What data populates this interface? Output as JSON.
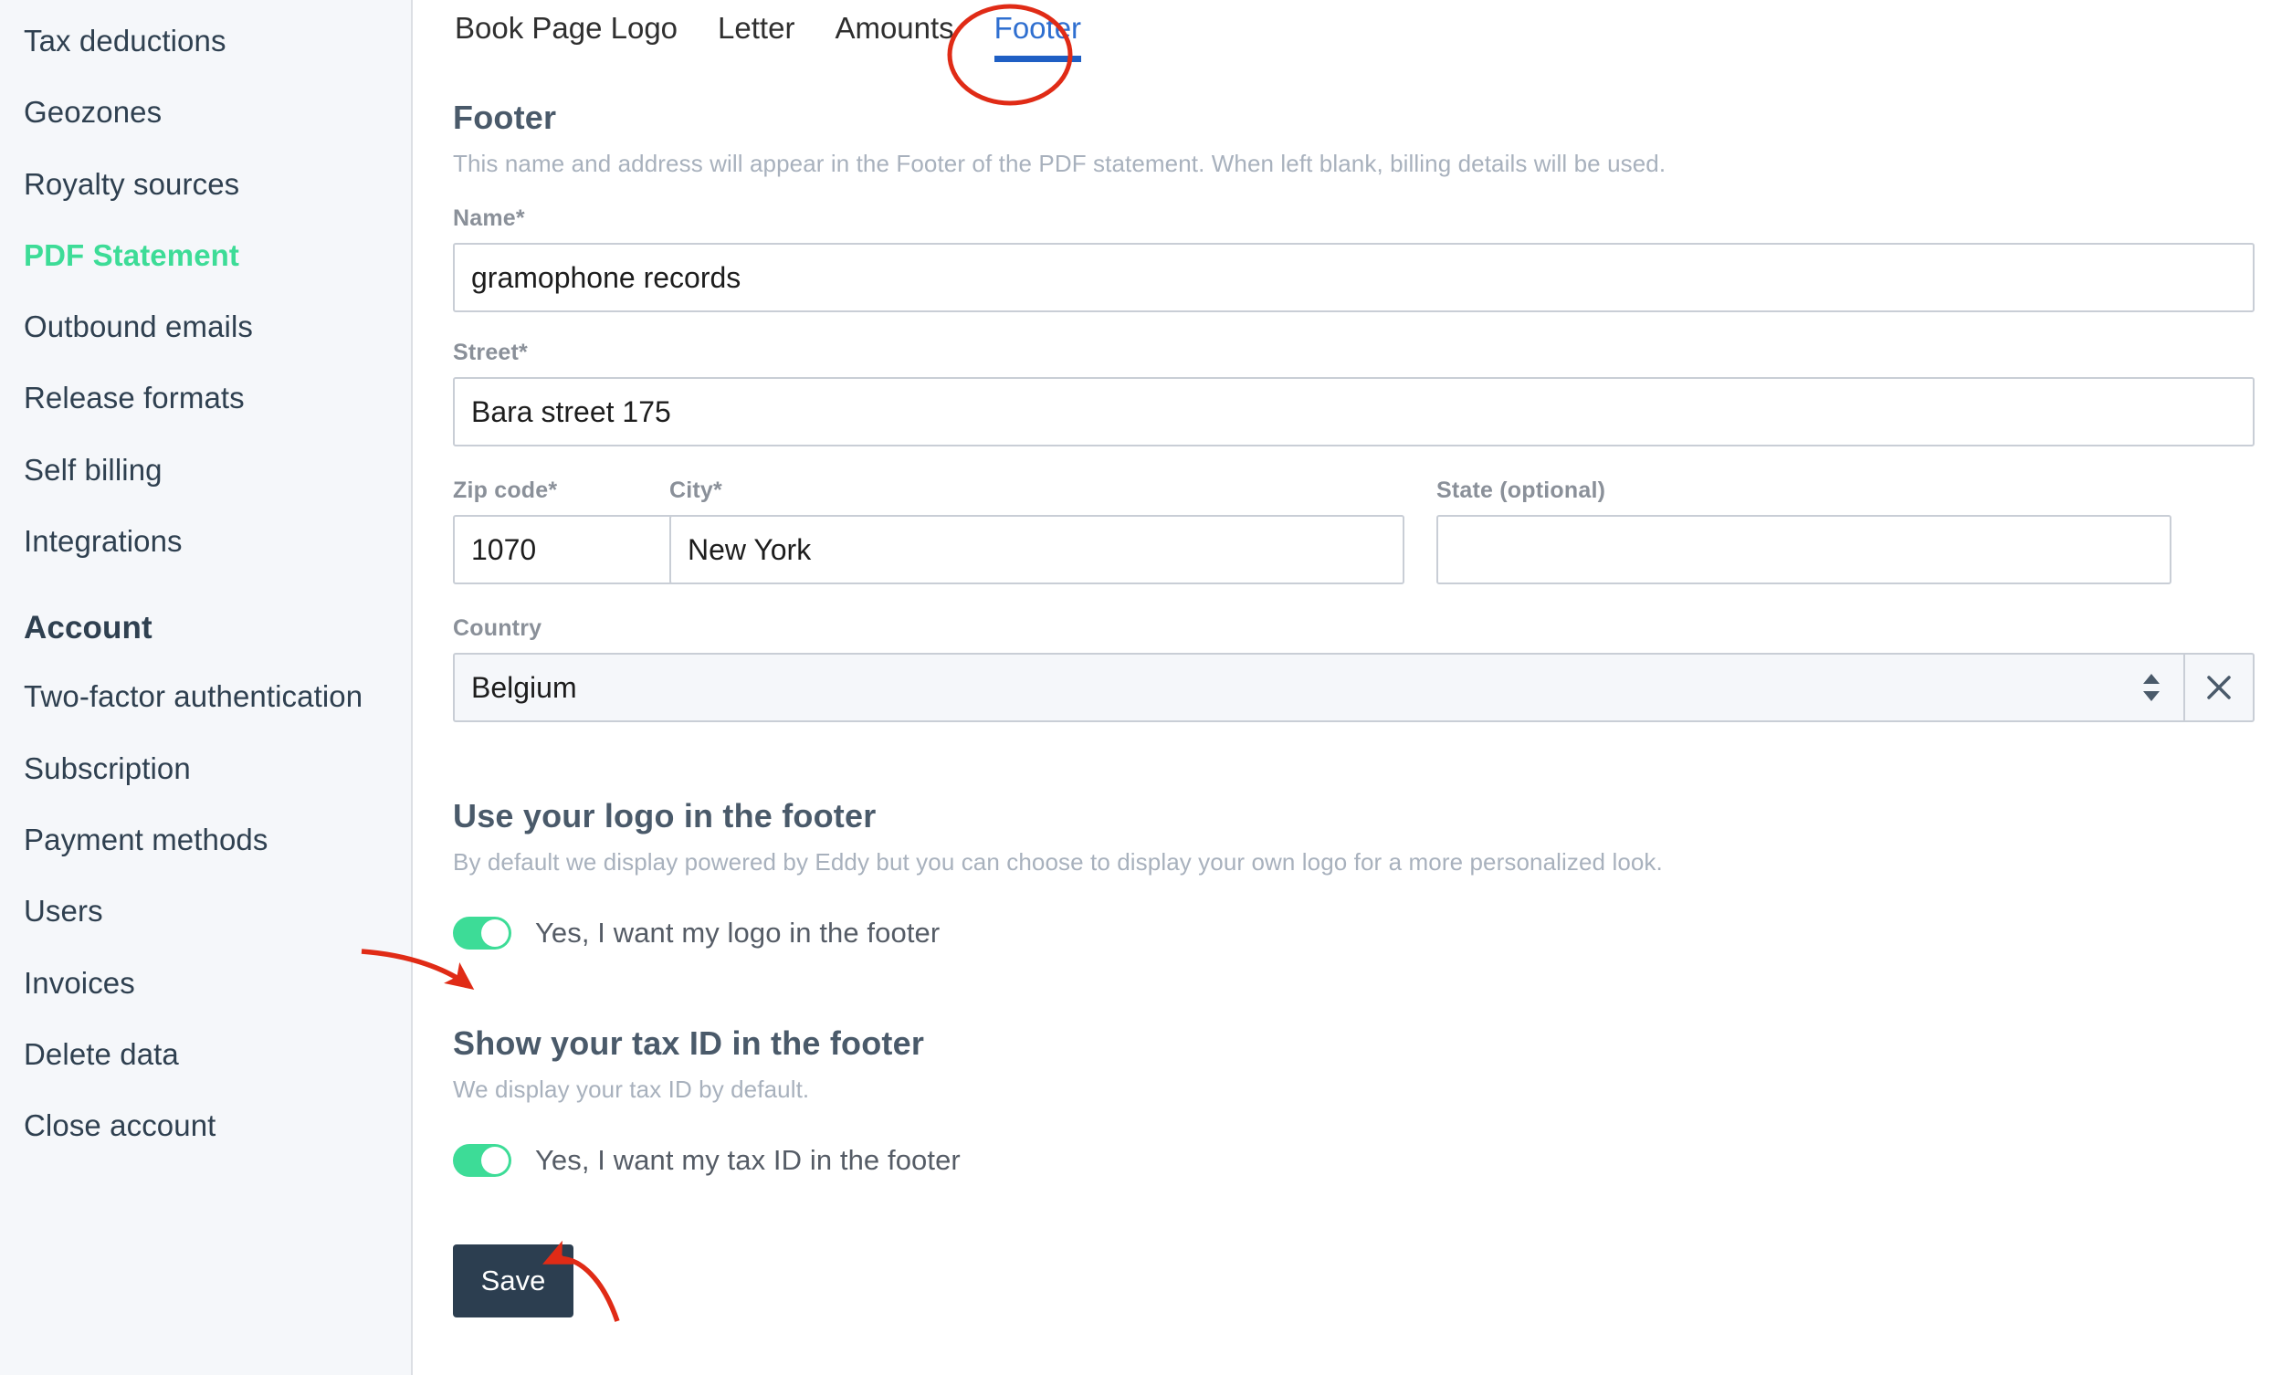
{
  "sidebar": {
    "items": [
      {
        "label": "Tax deductions",
        "active": false
      },
      {
        "label": "Geozones",
        "active": false
      },
      {
        "label": "Royalty sources",
        "active": false
      },
      {
        "label": "PDF Statement",
        "active": true
      },
      {
        "label": "Outbound emails",
        "active": false
      },
      {
        "label": "Release formats",
        "active": false
      },
      {
        "label": "Self billing",
        "active": false
      },
      {
        "label": "Integrations",
        "active": false
      }
    ],
    "account_section_title": "Account",
    "account_items": [
      {
        "label": "Two-factor authentication"
      },
      {
        "label": "Subscription"
      },
      {
        "label": "Payment methods"
      },
      {
        "label": "Users"
      },
      {
        "label": "Invoices"
      },
      {
        "label": "Delete data"
      },
      {
        "label": "Close account"
      }
    ]
  },
  "tabs": [
    {
      "label": "Book Page Logo",
      "active": false
    },
    {
      "label": "Letter",
      "active": false
    },
    {
      "label": "Amounts",
      "active": false
    },
    {
      "label": "Footer",
      "active": true
    }
  ],
  "footer_section": {
    "title": "Footer",
    "description": "This name and address will appear in the Footer of the PDF statement. When left blank, billing details will be used.",
    "fields": {
      "name": {
        "label": "Name*",
        "value": "gramophone records",
        "placeholder": ""
      },
      "street": {
        "label": "Street*",
        "value": "Bara street 175",
        "placeholder": ""
      },
      "zip": {
        "label": "Zip code*",
        "value": "1070",
        "placeholder": ""
      },
      "city": {
        "label": "City*",
        "value": "New York",
        "placeholder": ""
      },
      "state": {
        "label": "State (optional)",
        "value": "",
        "placeholder": ""
      },
      "country": {
        "label": "Country",
        "value": "Belgium",
        "clear_label": "×"
      }
    }
  },
  "logo_section": {
    "title": "Use your logo in the footer",
    "description": "By default we display powered by Eddy but you can choose to display your own logo for a more personalized look.",
    "toggle_label": "Yes, I want my logo in the footer",
    "toggle_on": true
  },
  "tax_section": {
    "title": "Show your tax ID in the footer",
    "description": "We display your tax ID by default.",
    "toggle_label": "Yes, I want my tax ID in the footer",
    "toggle_on": true
  },
  "actions": {
    "save_label": "Save"
  },
  "colors": {
    "accent_green": "#3ddc97",
    "tab_active_blue": "#2f6fd0",
    "tab_underline_blue": "#1f5fc4",
    "annotation_red": "#e02b16",
    "save_button": "#2c3e50",
    "sidebar_bg": "#f5f7fa",
    "muted_text": "#a8b1bd"
  }
}
